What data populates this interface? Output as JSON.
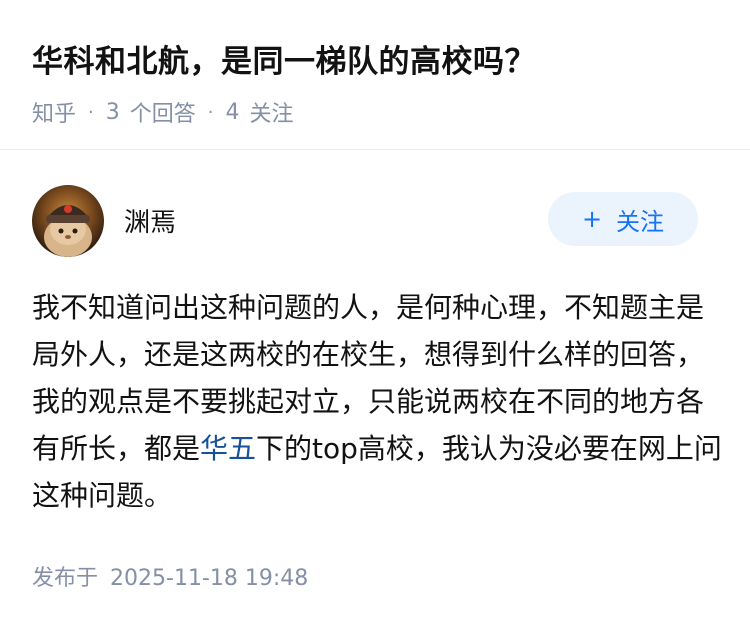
{
  "question": {
    "title": "华科和北航，是同一梯队的高校吗？",
    "source": "知乎",
    "answers_count": "3",
    "answers_label": "个回答",
    "followers_count": "4",
    "followers_label": "关注"
  },
  "answer": {
    "author": "渊焉",
    "follow_plus": "+",
    "follow_label": "关注",
    "text_before_link": "我不知道问出这种问题的人，是何种心理，不知题主是局外人，还是这两校的在校生，想得到什么样的回答，我的观点是不要挑起对立，只能说两校在不同的地方各有所长，都是",
    "link_text": "华五",
    "text_after_link": "下的top高校，我认为没必要在网上问这种问题。",
    "published_label": "发布于",
    "published_time": "2025-11-18 19:48"
  },
  "colors": {
    "accent": "#1772f6",
    "link": "#175199",
    "meta": "#8590a6",
    "button_bg": "#ebf3fc"
  }
}
